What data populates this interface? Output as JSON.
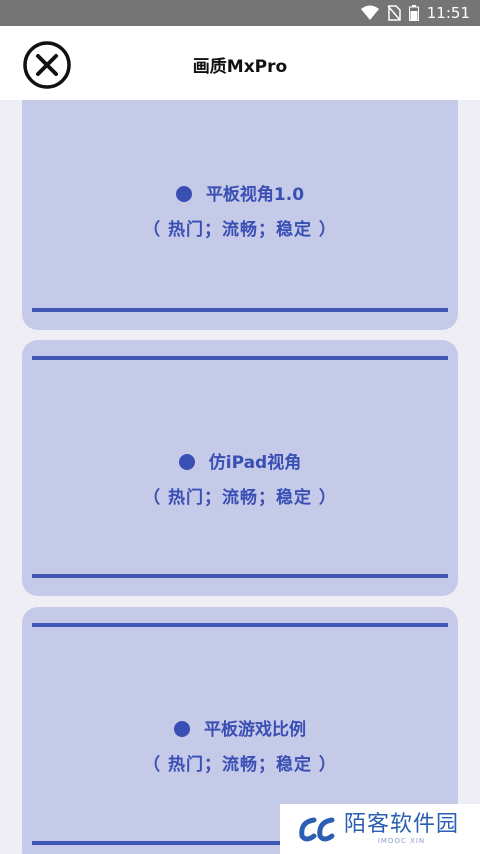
{
  "status_bar": {
    "time": "11:51"
  },
  "header": {
    "title": "画质MxPro"
  },
  "options": [
    {
      "name": "平板视角1.0",
      "tags": "（ 热门；流畅；稳定 ）"
    },
    {
      "name": "仿iPad视角",
      "tags": "（ 热门；流畅；稳定 ）"
    },
    {
      "name": "平板游戏比例",
      "tags": "（ 热门；流畅；稳定 ）"
    }
  ],
  "watermark": {
    "text": "陌客软件园",
    "subtext": "IMOOC XIN"
  },
  "colors": {
    "card": "#c6cae9",
    "accent": "#3f57b5",
    "background": "#efeef4"
  }
}
